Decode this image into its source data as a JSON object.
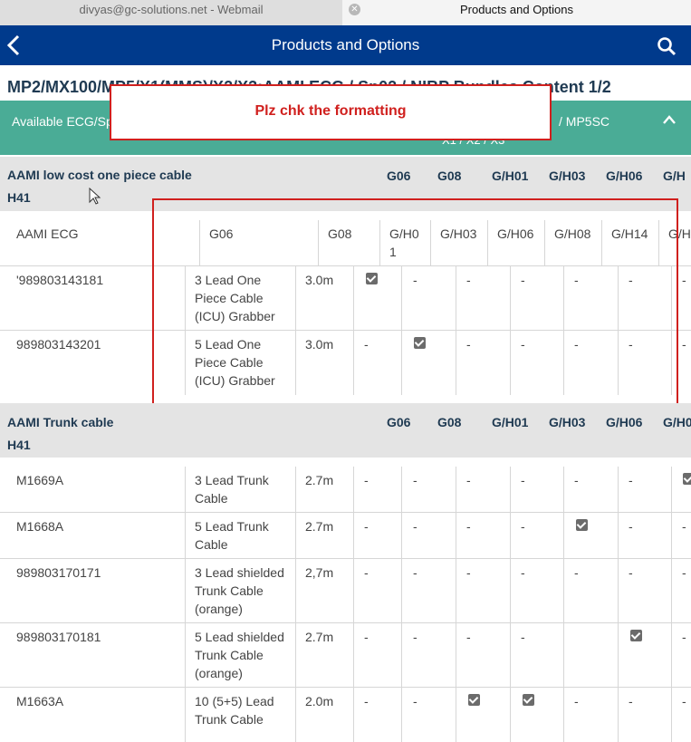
{
  "browser": {
    "tabs": [
      {
        "label": "divyas@gc-solutions.net - Webmail"
      },
      {
        "label": "Products and Options"
      }
    ]
  },
  "header": {
    "title": "Products and Options"
  },
  "page_title": "MP2/MX100/MP5/X1(MMS)/X2/X3:AAMI ECG / Sp02 / NIBP Bundles Content 1/2",
  "accordion": {
    "left_text": "Available ECG/Sp",
    "right_text": "/ MP5SC",
    "sub_text": "X1 / X2 / X3"
  },
  "annotation": {
    "note": "Plz chk the formatting"
  },
  "section1": {
    "name_line1": "AAMI low cost one piece cable",
    "name_line2": "H41",
    "cols": [
      "G06",
      "G08",
      "G/H01",
      "G/H03",
      "G/H06",
      "G/H"
    ]
  },
  "subheader": {
    "label": "AAMI ECG",
    "cols": [
      "G06",
      "G08",
      "G/H0",
      "1",
      "G/H03",
      "G/H06",
      "G/H08",
      "G/H14",
      "G/H"
    ]
  },
  "section1_rows": [
    {
      "part": "'989803143181",
      "desc": [
        "3 Lead One",
        "Piece Cable",
        "(ICU) Grabber"
      ],
      "len": "3.0m",
      "v": [
        "✓",
        "-",
        "-",
        "-",
        "-",
        "-",
        "-"
      ]
    },
    {
      "part": "989803143201",
      "desc": [
        "5 Lead One",
        "Piece Cable",
        "(ICU) Grabber"
      ],
      "len": "3.0m",
      "v": [
        "-",
        "✓",
        "-",
        "-",
        "-",
        "-",
        "-"
      ]
    }
  ],
  "section2": {
    "name_line1": "AAMI Trunk cable",
    "name_line2": "H41",
    "cols": [
      "G06",
      "G08",
      "G/H01",
      "G/H03",
      "G/H06",
      "G/H0"
    ]
  },
  "section2_rows": [
    {
      "part": "M1669A",
      "desc": [
        "3 Lead Trunk",
        "Cable"
      ],
      "len": "2.7m",
      "v": [
        "-",
        "-",
        "-",
        "-",
        "-",
        "-",
        "✓"
      ]
    },
    {
      "part": "M1668A",
      "desc": [
        "5 Lead Trunk",
        "Cable"
      ],
      "len": "2.7m",
      "v": [
        "-",
        "-",
        "-",
        "-",
        "✓",
        "-",
        "-"
      ]
    },
    {
      "part": "989803170171",
      "desc": [
        "3 Lead shielded",
        "Trunk Cable",
        "(orange)"
      ],
      "len": "2,7m",
      "v": [
        "-",
        "-",
        "-",
        "-",
        "-",
        "-",
        "-"
      ]
    },
    {
      "part": "989803170181",
      "desc": [
        "5 Lead shielded",
        "Trunk Cable",
        "(orange)"
      ],
      "len": "2.7m",
      "v": [
        "-",
        "-",
        "-",
        "-",
        "",
        "✓",
        "-"
      ]
    },
    {
      "part": "M1663A",
      "desc": [
        "10 (5+5) Lead",
        "Trunk Cable"
      ],
      "len": "2.0m",
      "v": [
        "-",
        "-",
        "✓",
        "✓",
        "-",
        "-",
        "-"
      ]
    }
  ],
  "colors": {
    "app_bar": "#003a8c",
    "accordion": "#4aac96",
    "section_bg": "#e4e4e4",
    "highlight": "#d0201e"
  }
}
